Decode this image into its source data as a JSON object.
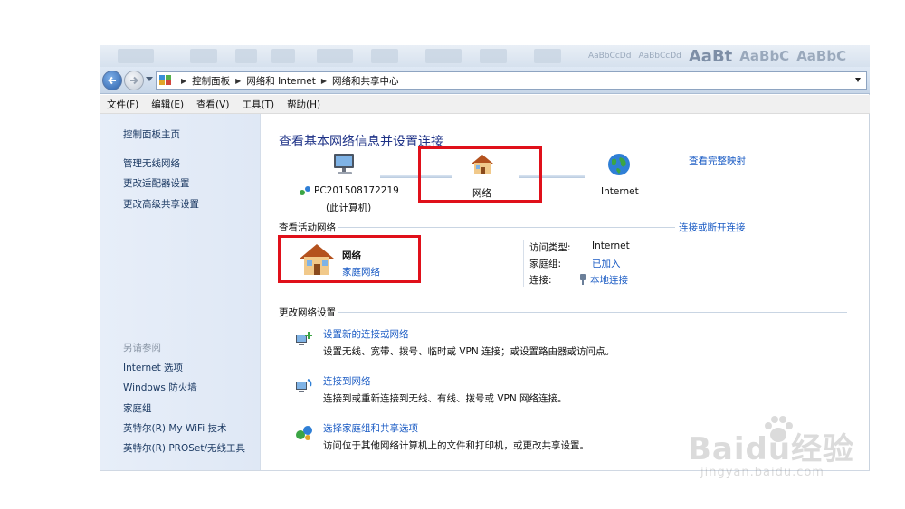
{
  "ribbon": {
    "style_samples": [
      "AaBbCcDd",
      "AaBbCcDd",
      "AaBt",
      "AaBbC",
      "AaBbC"
    ]
  },
  "address": {
    "crumbs": [
      "控制面板",
      "网络和 Internet",
      "网络和共享中心"
    ]
  },
  "menu": [
    "文件(F)",
    "编辑(E)",
    "查看(V)",
    "工具(T)",
    "帮助(H)"
  ],
  "sidebar": {
    "home": "控制面板主页",
    "items": [
      "管理无线网络",
      "更改适配器设置",
      "更改高级共享设置"
    ],
    "see_also_title": "另请参阅",
    "see_also": [
      "Internet 选项",
      "Windows 防火墙",
      "家庭组",
      "英特尔(R) My WiFi 技术",
      "英特尔(R) PROSet/无线工具"
    ]
  },
  "main": {
    "title": "查看基本网络信息并设置连接",
    "full_map": "查看完整映射",
    "map": {
      "computer_name": "PC201508172219",
      "computer_sub": "(此计算机)",
      "network": "网络",
      "internet": "Internet"
    },
    "active_header": "查看活动网络",
    "connect_link": "连接或断开连接",
    "active": {
      "name": "网络",
      "type": "家庭网络",
      "access_type_label": "访问类型:",
      "access_type_value": "Internet",
      "homegroup_label": "家庭组:",
      "homegroup_value": "已加入",
      "connection_label": "连接:",
      "connection_value": "本地连接"
    },
    "change_header": "更改网络设置",
    "tasks": [
      {
        "link": "设置新的连接或网络",
        "desc": "设置无线、宽带、拨号、临时或 VPN 连接；或设置路由器或访问点。"
      },
      {
        "link": "连接到网络",
        "desc": "连接到或重新连接到无线、有线、拨号或 VPN 网络连接。"
      },
      {
        "link": "选择家庭组和共享选项",
        "desc": "访问位于其他网络计算机上的文件和打印机，或更改共享设置。"
      }
    ]
  },
  "watermark": {
    "brand": "Baidu",
    "cn": "经验",
    "url": "jingyan.baidu.com"
  },
  "colors": {
    "accent_link": "#1a5bc4",
    "title": "#1e3287",
    "highlight_box": "#e0101a"
  }
}
